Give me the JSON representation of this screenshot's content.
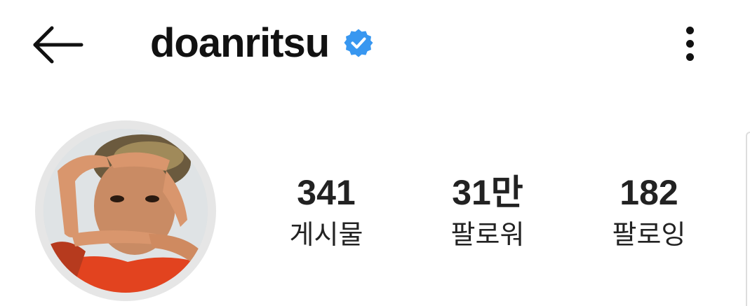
{
  "header": {
    "back_icon": "back-arrow-icon",
    "username": "doanritsu",
    "verified_icon": "verified-badge-icon",
    "verified_color": "#3897f0",
    "more_icon": "more-vertical-icon"
  },
  "profile": {
    "avatar_icon": "profile-photo"
  },
  "stats": {
    "posts": {
      "value": "341",
      "label": "게시물"
    },
    "followers": {
      "value": "31만",
      "label": "팔로워"
    },
    "following": {
      "value": "182",
      "label": "팔로잉"
    }
  }
}
